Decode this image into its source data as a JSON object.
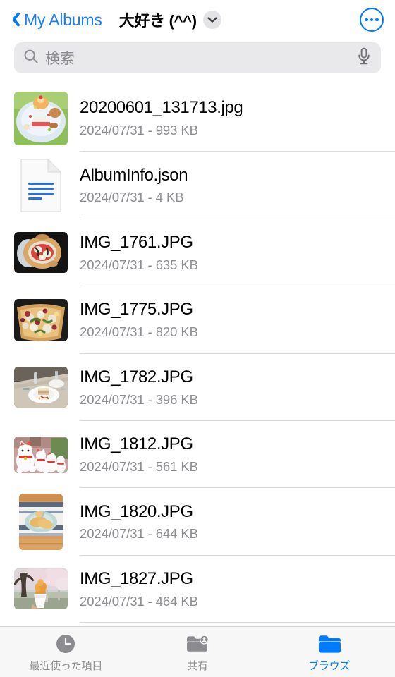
{
  "navbar": {
    "back_label": "My Albums",
    "back_icon": "chevron-left-icon",
    "title": "大好き (^^)",
    "title_chevron_icon": "chevron-down-icon",
    "more_icon": "ellipsis-circle-icon"
  },
  "search": {
    "placeholder": "検索",
    "value": "",
    "search_icon": "search-icon",
    "mic_icon": "microphone-icon"
  },
  "files": [
    {
      "name": "20200601_131713.jpg",
      "meta": "2024/07/31 - 993 KB",
      "date": "2024/07/31",
      "size": "993 KB",
      "thumb": "photo-dessert-plate"
    },
    {
      "name": "AlbumInfo.json",
      "meta": "2024/07/31 - 4 KB",
      "date": "2024/07/31",
      "size": "4 KB",
      "thumb": "document-json-icon"
    },
    {
      "name": "IMG_1761.JPG",
      "meta": "2024/07/31 - 635 KB",
      "date": "2024/07/31",
      "size": "635 KB",
      "thumb": "photo-pizza"
    },
    {
      "name": "IMG_1775.JPG",
      "meta": "2024/07/31 - 820 KB",
      "date": "2024/07/31",
      "size": "820 KB",
      "thumb": "photo-salad-bowl"
    },
    {
      "name": "IMG_1782.JPG",
      "meta": "2024/07/31 - 396 KB",
      "date": "2024/07/31",
      "size": "396 KB",
      "thumb": "photo-restaurant-table"
    },
    {
      "name": "IMG_1812.JPG",
      "meta": "2024/07/31 - 561 KB",
      "date": "2024/07/31",
      "size": "561 KB",
      "thumb": "photo-lucky-cats"
    },
    {
      "name": "IMG_1820.JPG",
      "meta": "2024/07/31 - 644 KB",
      "date": "2024/07/31",
      "size": "644 KB",
      "thumb": "photo-pancakes"
    },
    {
      "name": "IMG_1827.JPG",
      "meta": "2024/07/31 - 464 KB",
      "date": "2024/07/31",
      "size": "464 KB",
      "thumb": "photo-cherry-blossom-cone"
    }
  ],
  "tabbar": {
    "items": [
      {
        "label": "最近使った項目",
        "icon": "clock-icon",
        "active": false
      },
      {
        "label": "共有",
        "icon": "shared-folder-person-icon",
        "active": false
      },
      {
        "label": "ブラウズ",
        "icon": "folder-icon",
        "active": true
      }
    ]
  },
  "colors": {
    "accent": "#007aff",
    "back_link": "#1a7cff",
    "meta_text": "#8e8e93",
    "search_bg": "#e9e9eb",
    "tabbar_bg": "#f7f7f7",
    "separator": "#dcdcdc",
    "inactive_tab": "#8e8e93"
  }
}
